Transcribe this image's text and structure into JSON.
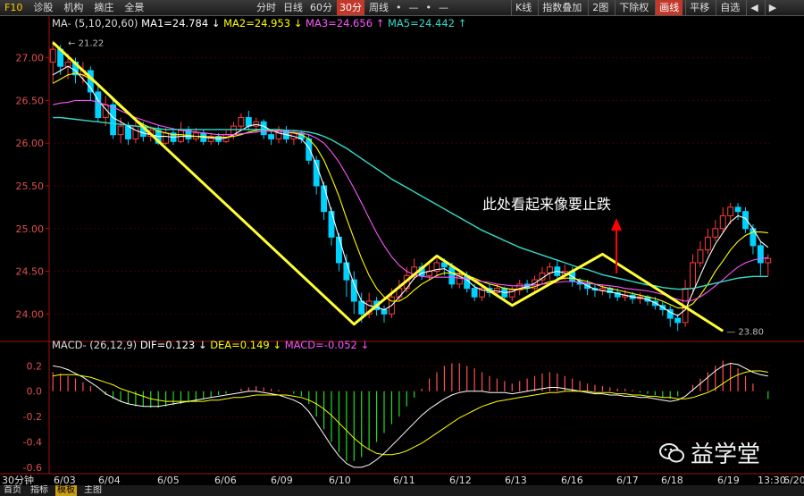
{
  "toolbar": {
    "left": [
      "F10",
      "诊股",
      "机构",
      "摘庄",
      "全景"
    ],
    "periods": [
      "分时",
      "日线",
      "60分",
      "30分",
      "周线",
      "•",
      "—",
      "•",
      "—"
    ],
    "active_period": "30分",
    "right": [
      "K线",
      "指数叠加",
      "2图",
      "下除权",
      "画线",
      "平移",
      "自选",
      "◀",
      "▶"
    ],
    "active_right": "画线"
  },
  "legend": {
    "ma_label": "MA-",
    "ma_params": "(5,10,20,60)",
    "ma1": "MA1=24.784",
    "ma2": "MA2=24.953",
    "ma3": "MA3=24.656",
    "ma5": "MA5=24.442",
    "macd_label": "MACD-",
    "macd_params": "(26,12,9)",
    "dif": "DIF=0.123",
    "dea": "DEA=0.149",
    "macd": "MACD=-0.052"
  },
  "annotation": "此处看起来像要止跌",
  "high_label": "21.22",
  "low_label": "23.80",
  "colors": {
    "up": "#ff3c3c",
    "down": "#00d2ff",
    "ma1": "#ffffff",
    "ma2": "#ffff00",
    "ma3": "#ff55ff",
    "ma5": "#33ddcc",
    "zigzag": "#ffff33",
    "annotation_arrow": "#ff0000",
    "macd_up": "#ff5050",
    "macd_down": "#22dd22"
  },
  "chart_data": {
    "type": "candlestick",
    "price_axis": {
      "ticks": [
        "27.00",
        "26.50",
        "26.00",
        "25.50",
        "25.00",
        "24.50",
        "24.00"
      ],
      "ylim": [
        23.7,
        27.3
      ]
    },
    "macd_axis": {
      "ticks": [
        "0.2",
        "0.0",
        "-0.2",
        "-0.4",
        "-0.6"
      ],
      "ylim": [
        -0.65,
        0.28
      ]
    },
    "x_labels": [
      "30分钟",
      "6/03",
      "6/04",
      "6/05",
      "6/06",
      "6/09",
      "6/10",
      "6/11",
      "6/12",
      "6/13",
      "6/16",
      "6/17",
      "6/18",
      "6/19",
      "13:30",
      "6/20"
    ],
    "candles": [
      [
        26.95,
        27.1,
        27.2,
        26.7
      ],
      [
        27.1,
        26.9,
        27.15,
        26.8
      ],
      [
        26.9,
        26.95,
        27.05,
        26.75
      ],
      [
        26.95,
        26.8,
        27.0,
        26.7
      ],
      [
        26.8,
        26.85,
        26.95,
        26.7
      ],
      [
        26.85,
        26.6,
        26.9,
        26.5
      ],
      [
        26.6,
        26.3,
        26.7,
        26.25
      ],
      [
        26.3,
        26.45,
        26.55,
        26.2
      ],
      [
        26.45,
        26.1,
        26.5,
        26.05
      ],
      [
        26.1,
        26.2,
        26.3,
        26.0
      ],
      [
        26.2,
        26.05,
        26.25,
        25.98
      ],
      [
        26.05,
        26.2,
        26.25,
        26.0
      ],
      [
        26.2,
        26.08,
        26.25,
        26.02
      ],
      [
        26.08,
        26.15,
        26.2,
        26.02
      ],
      [
        26.15,
        26.0,
        26.2,
        25.98
      ],
      [
        26.0,
        26.12,
        26.18,
        25.98
      ],
      [
        26.12,
        26.02,
        26.15,
        25.98
      ],
      [
        26.02,
        26.15,
        26.25,
        26.0
      ],
      [
        26.15,
        26.05,
        26.2,
        26.0
      ],
      [
        26.05,
        26.12,
        26.18,
        26.02
      ],
      [
        26.12,
        26.02,
        26.16,
        25.98
      ],
      [
        26.02,
        26.08,
        26.12,
        25.98
      ],
      [
        26.08,
        26.02,
        26.12,
        25.98
      ],
      [
        26.02,
        26.1,
        26.15,
        26.0
      ],
      [
        26.1,
        26.2,
        26.25,
        26.05
      ],
      [
        26.2,
        26.3,
        26.35,
        26.15
      ],
      [
        26.3,
        26.2,
        26.38,
        26.15
      ],
      [
        26.2,
        26.25,
        26.3,
        26.12
      ],
      [
        26.25,
        26.1,
        26.28,
        26.05
      ],
      [
        26.1,
        26.05,
        26.15,
        25.98
      ],
      [
        26.05,
        26.15,
        26.2,
        26.0
      ],
      [
        26.15,
        26.05,
        26.2,
        26.0
      ],
      [
        26.05,
        26.12,
        26.15,
        25.98
      ],
      [
        26.12,
        26.05,
        26.15,
        26.0
      ],
      [
        26.05,
        25.8,
        26.1,
        25.75
      ],
      [
        25.8,
        25.5,
        25.85,
        25.4
      ],
      [
        25.5,
        25.2,
        25.55,
        25.1
      ],
      [
        25.2,
        24.9,
        25.25,
        24.8
      ],
      [
        24.9,
        24.6,
        24.95,
        24.5
      ],
      [
        24.6,
        24.4,
        24.7,
        24.2
      ],
      [
        24.4,
        24.15,
        24.5,
        24.0
      ],
      [
        24.15,
        24.0,
        24.25,
        23.9
      ],
      [
        24.0,
        24.15,
        24.25,
        23.95
      ],
      [
        24.15,
        24.05,
        24.2,
        23.98
      ],
      [
        24.05,
        24.0,
        24.1,
        23.9
      ],
      [
        24.0,
        24.2,
        24.3,
        23.95
      ],
      [
        24.2,
        24.3,
        24.4,
        24.15
      ],
      [
        24.3,
        24.45,
        24.55,
        24.25
      ],
      [
        24.45,
        24.55,
        24.65,
        24.4
      ],
      [
        24.55,
        24.45,
        24.6,
        24.4
      ],
      [
        24.45,
        24.5,
        24.6,
        24.4
      ],
      [
        24.5,
        24.6,
        24.65,
        24.45
      ],
      [
        24.6,
        24.55,
        24.65,
        24.45
      ],
      [
        24.55,
        24.35,
        24.6,
        24.3
      ],
      [
        24.35,
        24.45,
        24.5,
        24.3
      ],
      [
        24.45,
        24.3,
        24.5,
        24.25
      ],
      [
        24.3,
        24.2,
        24.35,
        24.15
      ],
      [
        24.2,
        24.3,
        24.35,
        24.15
      ],
      [
        24.3,
        24.25,
        24.35,
        24.2
      ],
      [
        24.25,
        24.3,
        24.35,
        24.2
      ],
      [
        24.3,
        24.2,
        24.32,
        24.15
      ],
      [
        24.2,
        24.28,
        24.32,
        24.15
      ],
      [
        24.28,
        24.35,
        24.4,
        24.22
      ],
      [
        24.35,
        24.3,
        24.4,
        24.25
      ],
      [
        24.3,
        24.4,
        24.45,
        24.25
      ],
      [
        24.4,
        24.48,
        24.55,
        24.35
      ],
      [
        24.48,
        24.55,
        24.6,
        24.4
      ],
      [
        24.55,
        24.45,
        24.62,
        24.4
      ],
      [
        24.45,
        24.5,
        24.58,
        24.4
      ],
      [
        24.5,
        24.38,
        24.55,
        24.32
      ],
      [
        24.38,
        24.35,
        24.42,
        24.28
      ],
      [
        24.35,
        24.3,
        24.4,
        24.22
      ],
      [
        24.3,
        24.28,
        24.35,
        24.2
      ],
      [
        24.28,
        24.3,
        24.35,
        24.22
      ],
      [
        24.3,
        24.25,
        24.32,
        24.18
      ],
      [
        24.25,
        24.2,
        24.3,
        24.15
      ],
      [
        24.2,
        24.22,
        24.28,
        24.15
      ],
      [
        24.22,
        24.18,
        24.26,
        24.12
      ],
      [
        24.18,
        24.2,
        24.25,
        24.12
      ],
      [
        24.2,
        24.15,
        24.22,
        24.1
      ],
      [
        24.15,
        24.1,
        24.2,
        24.05
      ],
      [
        24.1,
        24.05,
        24.15,
        23.98
      ],
      [
        24.05,
        23.95,
        24.1,
        23.85
      ],
      [
        23.95,
        23.9,
        24.0,
        23.8
      ],
      [
        23.9,
        24.3,
        24.4,
        23.85
      ],
      [
        24.3,
        24.6,
        24.7,
        24.25
      ],
      [
        24.6,
        24.75,
        24.85,
        24.55
      ],
      [
        24.75,
        24.9,
        25.0,
        24.7
      ],
      [
        24.9,
        25.0,
        25.1,
        24.85
      ],
      [
        25.0,
        25.15,
        25.25,
        24.95
      ],
      [
        25.15,
        25.25,
        25.3,
        25.05
      ],
      [
        25.25,
        25.2,
        25.3,
        25.1
      ],
      [
        25.2,
        25.0,
        25.25,
        24.95
      ],
      [
        25.0,
        24.8,
        25.05,
        24.7
      ],
      [
        24.8,
        24.6,
        24.85,
        24.45
      ],
      [
        24.6,
        24.65,
        24.7,
        24.45
      ]
    ],
    "ma_series": [
      {
        "name": "MA1",
        "values": [
          26.8,
          26.85,
          26.9,
          26.85,
          26.75,
          26.65,
          26.5,
          26.4,
          26.3,
          26.25,
          26.2,
          26.15,
          26.12,
          26.1,
          26.08,
          26.08,
          26.07,
          26.08,
          26.08,
          26.08,
          26.07,
          26.06,
          26.05,
          26.06,
          26.1,
          26.15,
          26.2,
          26.22,
          26.2,
          26.15,
          26.12,
          26.1,
          26.08,
          26.05,
          25.95,
          25.75,
          25.5,
          25.2,
          24.9,
          24.6,
          24.35,
          24.15,
          24.1,
          24.08,
          24.05,
          24.1,
          24.2,
          24.3,
          24.42,
          24.48,
          24.5,
          24.52,
          24.53,
          24.48,
          24.44,
          24.4,
          24.32,
          24.28,
          24.27,
          24.27,
          24.25,
          24.26,
          24.3,
          24.32,
          24.36,
          24.42,
          24.48,
          24.5,
          24.48,
          24.44,
          24.38,
          24.33,
          24.29,
          24.27,
          24.26,
          24.24,
          24.22,
          24.2,
          24.19,
          24.17,
          24.13,
          24.08,
          24.02,
          23.98,
          24.05,
          24.25,
          24.45,
          24.65,
          24.82,
          24.95,
          25.08,
          25.15,
          25.12,
          25.0,
          24.85,
          24.78
        ]
      },
      {
        "name": "MA2",
        "values": [
          26.7,
          26.75,
          26.8,
          26.82,
          26.8,
          26.75,
          26.68,
          26.6,
          26.5,
          26.42,
          26.35,
          26.28,
          26.22,
          26.18,
          26.14,
          26.12,
          26.1,
          26.1,
          26.09,
          26.08,
          26.08,
          26.07,
          26.07,
          26.07,
          26.08,
          26.1,
          26.13,
          26.15,
          26.16,
          26.15,
          26.14,
          26.13,
          26.12,
          26.1,
          26.05,
          25.95,
          25.8,
          25.6,
          25.38,
          25.12,
          24.88,
          24.65,
          24.45,
          24.3,
          24.2,
          24.15,
          24.15,
          24.2,
          24.28,
          24.35,
          24.4,
          24.45,
          24.48,
          24.48,
          24.47,
          24.45,
          24.42,
          24.38,
          24.35,
          24.33,
          24.3,
          24.29,
          24.29,
          24.3,
          24.32,
          24.35,
          24.38,
          24.4,
          24.42,
          24.42,
          24.4,
          24.38,
          24.35,
          24.32,
          24.3,
          24.28,
          24.26,
          24.24,
          24.22,
          24.2,
          24.18,
          24.15,
          24.11,
          24.07,
          24.07,
          24.12,
          24.22,
          24.35,
          24.5,
          24.62,
          24.75,
          24.85,
          24.92,
          24.96,
          24.96,
          24.95
        ]
      },
      {
        "name": "MA3",
        "values": [
          26.45,
          26.47,
          26.48,
          26.5,
          26.5,
          26.5,
          26.48,
          26.45,
          26.42,
          26.38,
          26.34,
          26.3,
          26.27,
          26.24,
          26.21,
          26.19,
          26.17,
          26.15,
          26.14,
          26.13,
          26.12,
          26.11,
          26.1,
          26.1,
          26.1,
          26.11,
          26.12,
          26.13,
          26.14,
          26.14,
          26.14,
          26.13,
          26.13,
          26.12,
          26.1,
          26.06,
          26.0,
          25.9,
          25.78,
          25.63,
          25.47,
          25.3,
          25.12,
          24.95,
          24.8,
          24.67,
          24.57,
          24.5,
          24.46,
          24.44,
          24.43,
          24.43,
          24.43,
          24.43,
          24.42,
          24.41,
          24.4,
          24.38,
          24.37,
          24.35,
          24.34,
          24.33,
          24.33,
          24.33,
          24.34,
          24.35,
          24.36,
          24.37,
          24.38,
          24.38,
          24.37,
          24.36,
          24.35,
          24.34,
          24.33,
          24.32,
          24.3,
          24.29,
          24.28,
          24.27,
          24.25,
          24.23,
          24.2,
          24.17,
          24.15,
          24.16,
          24.2,
          24.26,
          24.33,
          24.4,
          24.48,
          24.55,
          24.6,
          24.63,
          24.65,
          24.66
        ]
      },
      {
        "name": "MA5",
        "values": [
          26.3,
          26.3,
          26.29,
          26.28,
          26.27,
          26.26,
          26.25,
          26.24,
          26.23,
          26.22,
          26.21,
          26.2,
          26.19,
          26.18,
          26.17,
          26.16,
          26.16,
          26.16,
          26.16,
          26.16,
          26.16,
          26.16,
          26.16,
          26.16,
          26.16,
          26.16,
          26.16,
          26.16,
          26.16,
          26.16,
          26.16,
          26.15,
          26.15,
          26.14,
          26.13,
          26.11,
          26.08,
          26.04,
          25.99,
          25.94,
          25.88,
          25.82,
          25.76,
          25.7,
          25.64,
          25.58,
          25.53,
          25.48,
          25.43,
          25.38,
          25.33,
          25.28,
          25.23,
          25.18,
          25.13,
          25.08,
          25.03,
          24.98,
          24.94,
          24.9,
          24.86,
          24.82,
          24.78,
          24.75,
          24.72,
          24.69,
          24.66,
          24.63,
          24.6,
          24.57,
          24.54,
          24.52,
          24.49,
          24.46,
          24.44,
          24.42,
          24.4,
          24.38,
          24.36,
          24.34,
          24.33,
          24.31,
          24.3,
          24.29,
          24.29,
          24.3,
          24.32,
          24.34,
          24.36,
          24.38,
          24.4,
          24.42,
          24.43,
          24.44,
          24.44,
          24.44
        ]
      }
    ],
    "zigzag": [
      [
        0,
        27.18
      ],
      [
        40,
        23.88
      ],
      [
        51,
        24.68
      ],
      [
        61,
        24.1
      ],
      [
        73,
        24.7
      ],
      [
        89,
        23.8
      ]
    ],
    "macd_hist": [
      0.15,
      0.14,
      0.12,
      0.1,
      0.07,
      0.04,
      0.0,
      -0.03,
      -0.06,
      -0.08,
      -0.1,
      -0.12,
      -0.12,
      -0.13,
      -0.13,
      -0.12,
      -0.11,
      -0.1,
      -0.09,
      -0.08,
      -0.06,
      -0.05,
      -0.03,
      -0.02,
      0.0,
      0.02,
      0.03,
      0.04,
      0.03,
      0.02,
      0.01,
      0.0,
      -0.02,
      -0.04,
      -0.1,
      -0.2,
      -0.3,
      -0.4,
      -0.48,
      -0.55,
      -0.55,
      -0.52,
      -0.46,
      -0.4,
      -0.33,
      -0.26,
      -0.2,
      -0.12,
      -0.05,
      0.02,
      0.1,
      0.15,
      0.2,
      0.22,
      0.22,
      0.2,
      0.18,
      0.15,
      0.12,
      0.1,
      0.08,
      0.06,
      0.08,
      0.1,
      0.12,
      0.14,
      0.15,
      0.14,
      0.12,
      0.1,
      0.08,
      0.06,
      0.05,
      0.04,
      0.03,
      0.02,
      0.02,
      0.01,
      -0.01,
      -0.02,
      -0.03,
      -0.05,
      -0.06,
      -0.04,
      0.0,
      0.05,
      0.1,
      0.15,
      0.2,
      0.24,
      0.22,
      0.18,
      0.12,
      0.06,
      0.0,
      -0.06
    ],
    "dif": [
      0.2,
      0.19,
      0.17,
      0.14,
      0.11,
      0.07,
      0.03,
      -0.02,
      -0.05,
      -0.08,
      -0.1,
      -0.11,
      -0.12,
      -0.12,
      -0.12,
      -0.11,
      -0.1,
      -0.09,
      -0.08,
      -0.07,
      -0.06,
      -0.05,
      -0.04,
      -0.03,
      -0.02,
      -0.01,
      0.0,
      0.0,
      -0.01,
      -0.02,
      -0.03,
      -0.05,
      -0.07,
      -0.1,
      -0.16,
      -0.25,
      -0.34,
      -0.43,
      -0.51,
      -0.57,
      -0.6,
      -0.6,
      -0.58,
      -0.54,
      -0.49,
      -0.43,
      -0.37,
      -0.31,
      -0.25,
      -0.19,
      -0.14,
      -0.1,
      -0.06,
      -0.03,
      -0.01,
      0.0,
      0.0,
      0.0,
      -0.01,
      -0.01,
      -0.01,
      -0.02,
      -0.01,
      0.0,
      0.01,
      0.02,
      0.03,
      0.03,
      0.02,
      0.01,
      0.0,
      -0.01,
      -0.02,
      -0.02,
      -0.03,
      -0.03,
      -0.04,
      -0.04,
      -0.05,
      -0.05,
      -0.06,
      -0.07,
      -0.08,
      -0.07,
      -0.04,
      0.01,
      0.06,
      0.11,
      0.16,
      0.2,
      0.22,
      0.21,
      0.18,
      0.15,
      0.13,
      0.12
    ],
    "dea": [
      0.12,
      0.13,
      0.13,
      0.13,
      0.12,
      0.11,
      0.09,
      0.07,
      0.05,
      0.02,
      0.0,
      -0.02,
      -0.04,
      -0.06,
      -0.07,
      -0.08,
      -0.08,
      -0.08,
      -0.08,
      -0.08,
      -0.08,
      -0.07,
      -0.07,
      -0.06,
      -0.05,
      -0.05,
      -0.04,
      -0.03,
      -0.03,
      -0.03,
      -0.03,
      -0.03,
      -0.04,
      -0.05,
      -0.07,
      -0.1,
      -0.14,
      -0.19,
      -0.25,
      -0.31,
      -0.37,
      -0.42,
      -0.46,
      -0.49,
      -0.5,
      -0.5,
      -0.49,
      -0.47,
      -0.44,
      -0.41,
      -0.37,
      -0.33,
      -0.29,
      -0.25,
      -0.21,
      -0.18,
      -0.15,
      -0.12,
      -0.1,
      -0.08,
      -0.07,
      -0.06,
      -0.05,
      -0.04,
      -0.03,
      -0.02,
      -0.01,
      -0.01,
      0.0,
      0.0,
      0.0,
      0.0,
      -0.01,
      -0.01,
      -0.01,
      -0.02,
      -0.02,
      -0.03,
      -0.03,
      -0.04,
      -0.04,
      -0.05,
      -0.05,
      -0.06,
      -0.06,
      -0.05,
      -0.03,
      -0.01,
      0.02,
      0.06,
      0.1,
      0.13,
      0.15,
      0.16,
      0.16,
      0.15
    ]
  }
}
